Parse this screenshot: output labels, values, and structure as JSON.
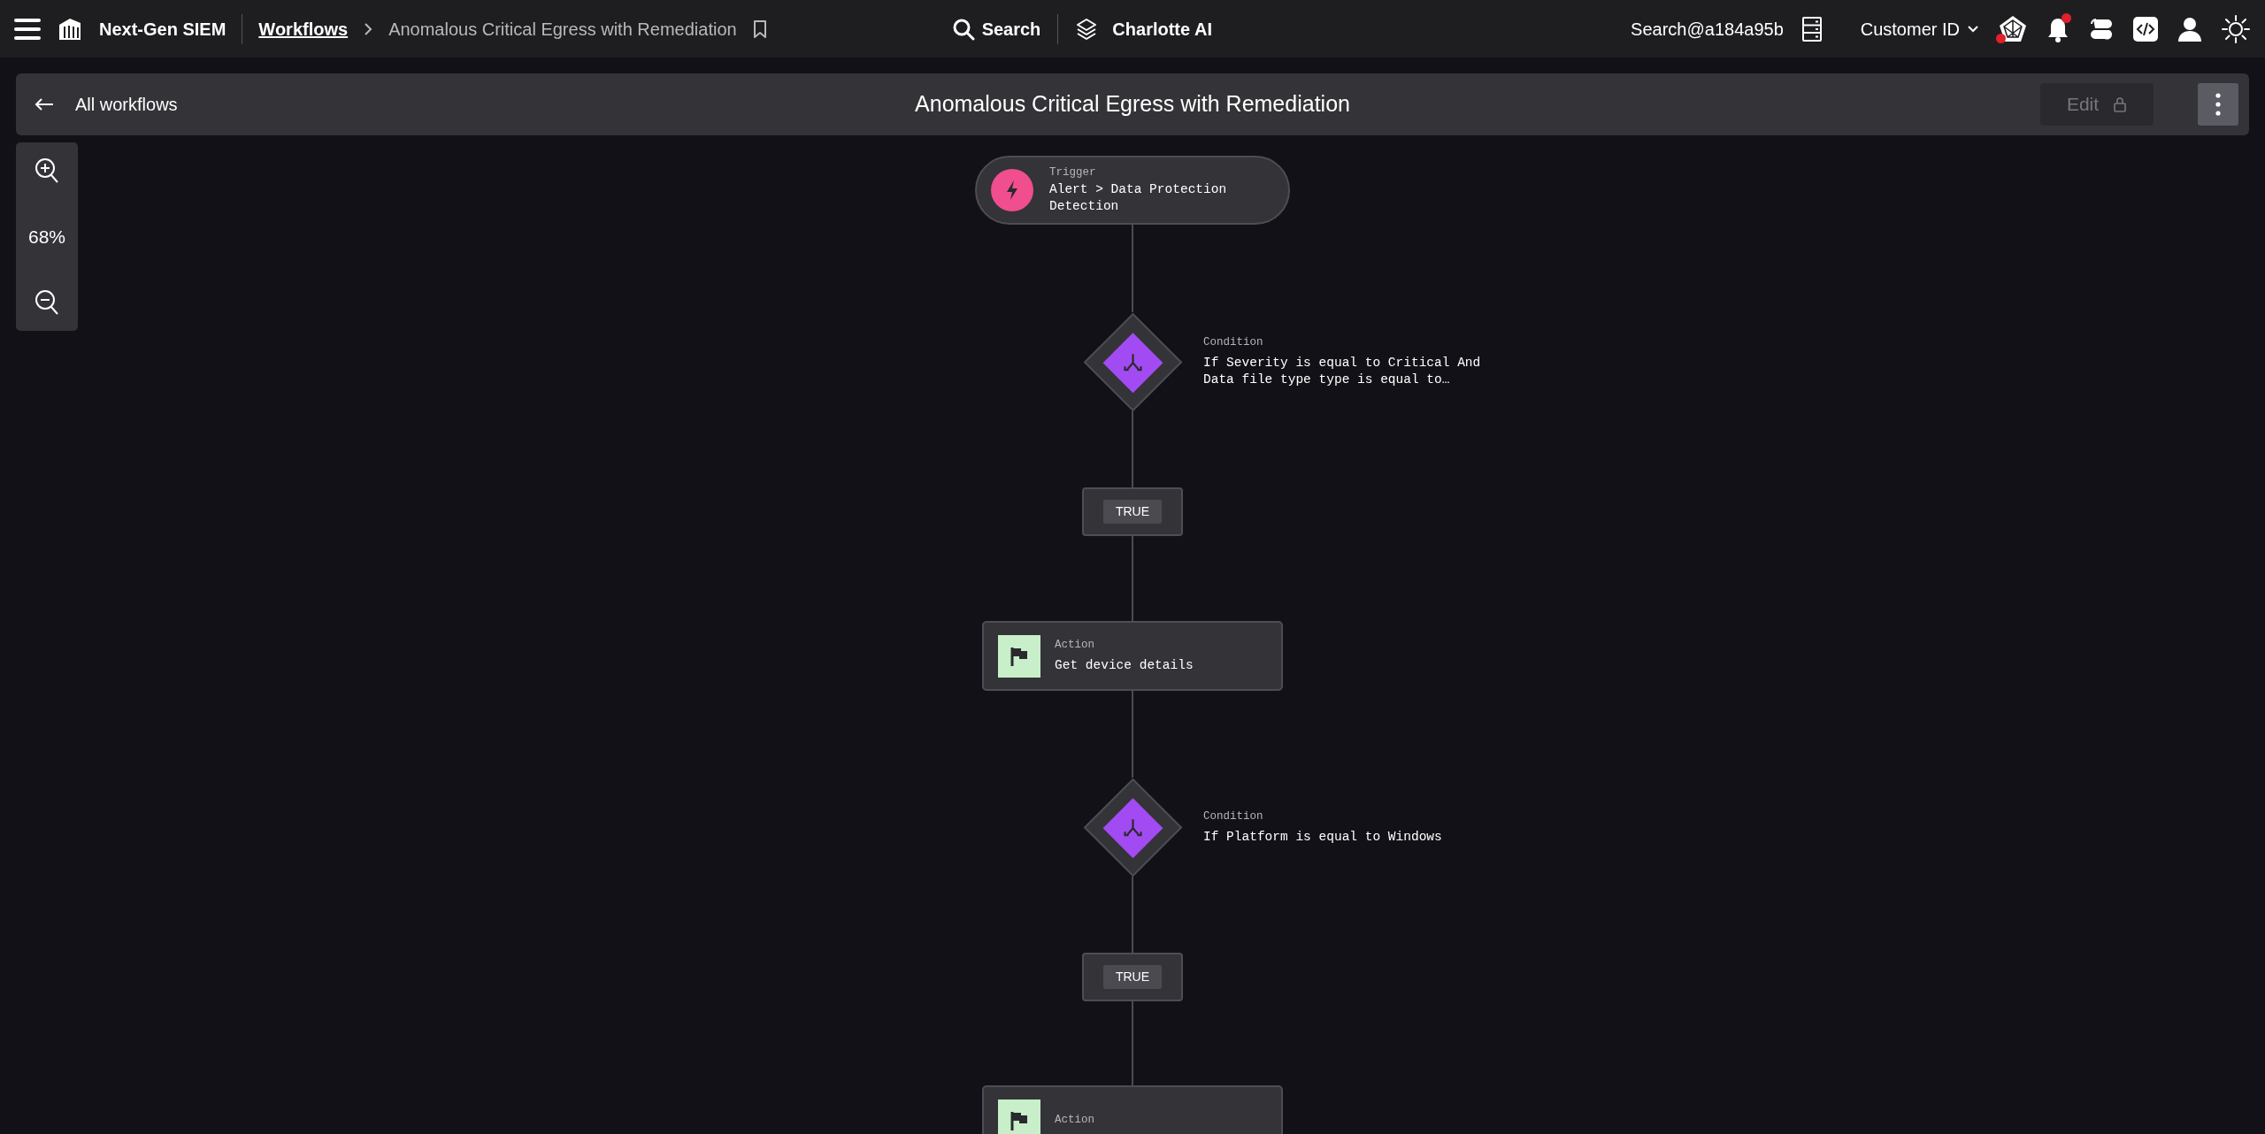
{
  "topbar": {
    "product": "Next-Gen SIEM",
    "breadcrumb": [
      {
        "label": "Workflows",
        "kind": "link"
      },
      {
        "label": "Anomalous Critical Egress with Remediation",
        "kind": "current"
      }
    ],
    "search": "Search",
    "assistant": "Charlotte AI",
    "user_search": "Search@a184a95b",
    "customer": "Customer ID"
  },
  "header": {
    "back": "All workflows",
    "title": "Anomalous Critical Egress with Remediation",
    "edit": {
      "label": "Edit",
      "disabled": true
    }
  },
  "zoom": {
    "level": "68%"
  },
  "flow": [
    {
      "kind": "trigger",
      "type": "Trigger",
      "text": "Alert > Data Protection Detection"
    },
    {
      "kind": "condition",
      "type": "Condition",
      "text": "If Severity is equal to Critical And Data file type type is equal to…"
    },
    {
      "kind": "branch",
      "text": "TRUE"
    },
    {
      "kind": "action",
      "type": "Action",
      "text": "Get device details"
    },
    {
      "kind": "condition",
      "type": "Condition",
      "text": "If Platform is equal to Windows"
    },
    {
      "kind": "branch",
      "text": "TRUE"
    },
    {
      "kind": "action",
      "type": "Action"
    }
  ]
}
